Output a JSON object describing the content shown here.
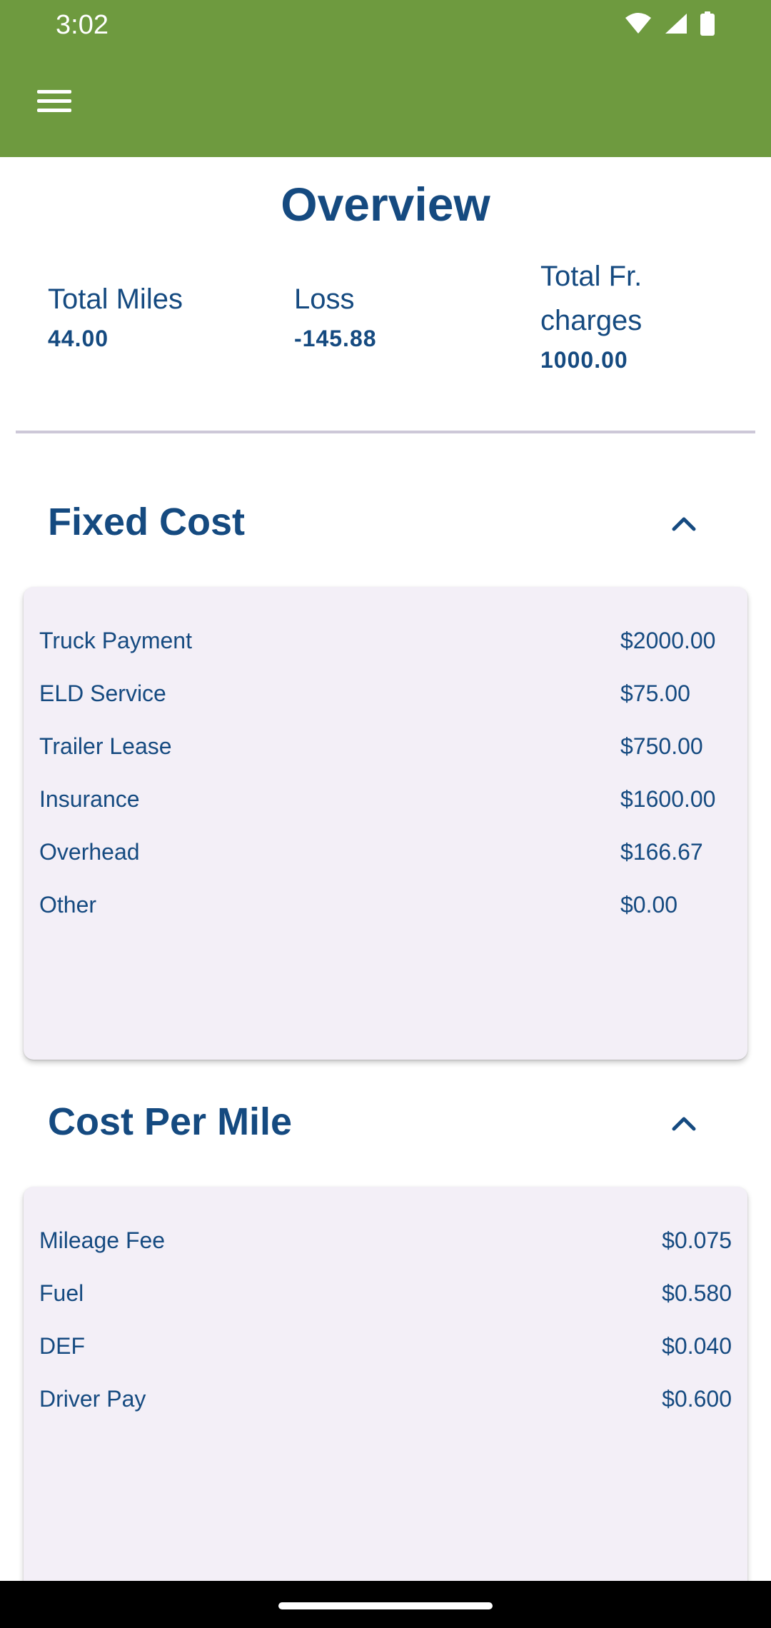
{
  "status_bar": {
    "time": "3:02",
    "icons": [
      "wifi-icon",
      "signal-icon",
      "battery-icon"
    ]
  },
  "app_bar": {
    "menu_icon": "menu-icon",
    "color": "#6e9a3f"
  },
  "overview": {
    "title": "Overview",
    "stats": [
      {
        "label": "Total Miles",
        "value": "44.00"
      },
      {
        "label": "Loss",
        "value": "-145.88"
      },
      {
        "label": "Total Fr. charges",
        "value": "1000.00"
      }
    ]
  },
  "fixed_cost": {
    "title": "Fixed Cost",
    "expanded_icon": "chevron-up-icon",
    "rows": [
      {
        "label": "Truck Payment",
        "value": "$2000.00"
      },
      {
        "label": "ELD Service",
        "value": "$75.00"
      },
      {
        "label": "Trailer Lease",
        "value": "$750.00"
      },
      {
        "label": "Insurance",
        "value": "$1600.00"
      },
      {
        "label": "Overhead",
        "value": "$166.67"
      },
      {
        "label": "Other",
        "value": "$0.00"
      }
    ]
  },
  "cost_per_mile": {
    "title": "Cost Per Mile",
    "expanded_icon": "chevron-up-icon",
    "rows": [
      {
        "label": "Mileage Fee",
        "value": "$0.075"
      },
      {
        "label": "Fuel",
        "value": "$0.580"
      },
      {
        "label": "DEF",
        "value": "$0.040"
      },
      {
        "label": "Driver Pay",
        "value": "$0.600"
      }
    ]
  },
  "colors": {
    "brand_green": "#6e9a3f",
    "text_blue": "#154a80",
    "card_bg": "#f3eff7"
  }
}
